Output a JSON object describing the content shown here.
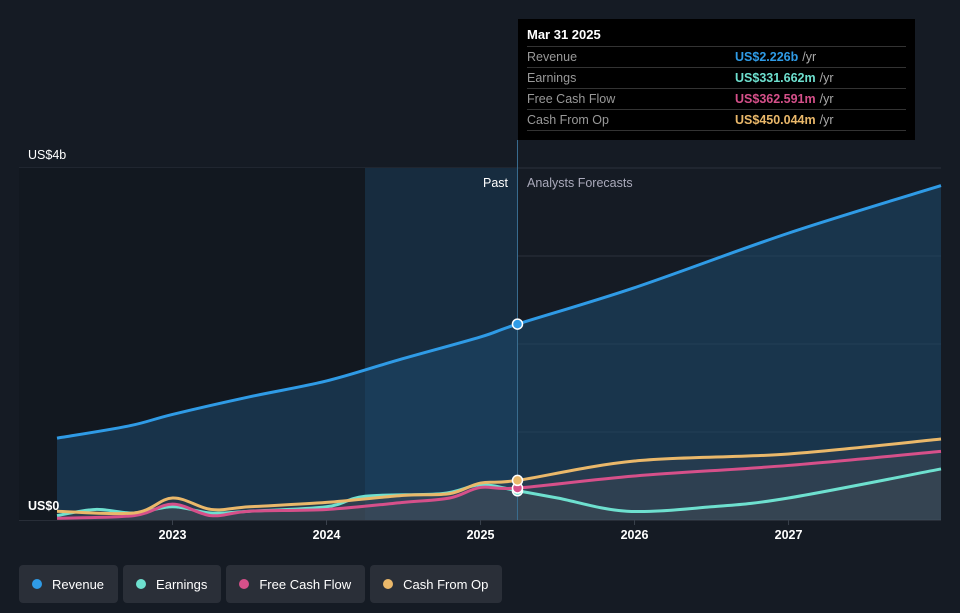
{
  "tooltip": {
    "date": "Mar 31 2025",
    "rows": [
      {
        "label": "Revenue",
        "value": "US$2.226b",
        "unit": "/yr",
        "color": "#2f9be6"
      },
      {
        "label": "Earnings",
        "value": "US$331.662m",
        "unit": "/yr",
        "color": "#6ee0cf"
      },
      {
        "label": "Free Cash Flow",
        "value": "US$362.591m",
        "unit": "/yr",
        "color": "#d6508a"
      },
      {
        "label": "Cash From Op",
        "value": "US$450.044m",
        "unit": "/yr",
        "color": "#eab86a"
      }
    ]
  },
  "legend": [
    {
      "label": "Revenue",
      "color": "#2f9be6"
    },
    {
      "label": "Earnings",
      "color": "#6ee0cf"
    },
    {
      "label": "Free Cash Flow",
      "color": "#d6508a"
    },
    {
      "label": "Cash From Op",
      "color": "#eab86a"
    }
  ],
  "chart_data": {
    "type": "line",
    "ylabel_top": "US$4b",
    "ylabel_bottom": "US$0",
    "ylim": [
      0,
      4
    ],
    "xlim": [
      2022.25,
      2027.99
    ],
    "xticks": [
      2023,
      2024,
      2025,
      2026,
      2027
    ],
    "xtick_labels": [
      "2023",
      "2024",
      "2025",
      "2026",
      "2027"
    ],
    "past_label": "Past",
    "forecast_label": "Analysts Forecasts",
    "divider_x": 2025.24,
    "highlight_start": 2024.25,
    "series": [
      {
        "name": "Revenue",
        "color": "#2f9be6",
        "x": [
          2022.25,
          2022.72,
          2023,
          2023.5,
          2024,
          2024.47,
          2025,
          2025.24,
          2026,
          2027,
          2027.99
        ],
        "values": [
          0.93,
          1.07,
          1.2,
          1.4,
          1.58,
          1.82,
          2.08,
          2.226,
          2.64,
          3.26,
          3.8
        ]
      },
      {
        "name": "Earnings",
        "color": "#6ee0cf",
        "x": [
          2022.25,
          2022.5,
          2022.75,
          2023,
          2023.25,
          2023.5,
          2024,
          2024.25,
          2024.75,
          2025,
          2025.24,
          2025.5,
          2025.95,
          2026.5,
          2027,
          2027.99
        ],
        "values": [
          0.05,
          0.12,
          0.08,
          0.15,
          0.08,
          0.1,
          0.15,
          0.27,
          0.3,
          0.4,
          0.332,
          0.25,
          0.1,
          0.15,
          0.25,
          0.58
        ]
      },
      {
        "name": "Free Cash Flow",
        "color": "#d6508a",
        "x": [
          2022.25,
          2022.75,
          2023,
          2023.25,
          2023.5,
          2024,
          2024.5,
          2024.8,
          2025,
          2025.24,
          2026,
          2027,
          2027.99
        ],
        "values": [
          0.02,
          0.05,
          0.18,
          0.05,
          0.1,
          0.12,
          0.2,
          0.25,
          0.37,
          0.363,
          0.5,
          0.62,
          0.78
        ]
      },
      {
        "name": "Cash From Op",
        "color": "#eab86a",
        "x": [
          2022.25,
          2022.75,
          2023,
          2023.25,
          2023.5,
          2024,
          2024.5,
          2024.8,
          2025,
          2025.24,
          2026,
          2027,
          2027.99
        ],
        "values": [
          0.1,
          0.08,
          0.25,
          0.12,
          0.15,
          0.2,
          0.28,
          0.3,
          0.42,
          0.45,
          0.67,
          0.75,
          0.92
        ]
      }
    ]
  }
}
